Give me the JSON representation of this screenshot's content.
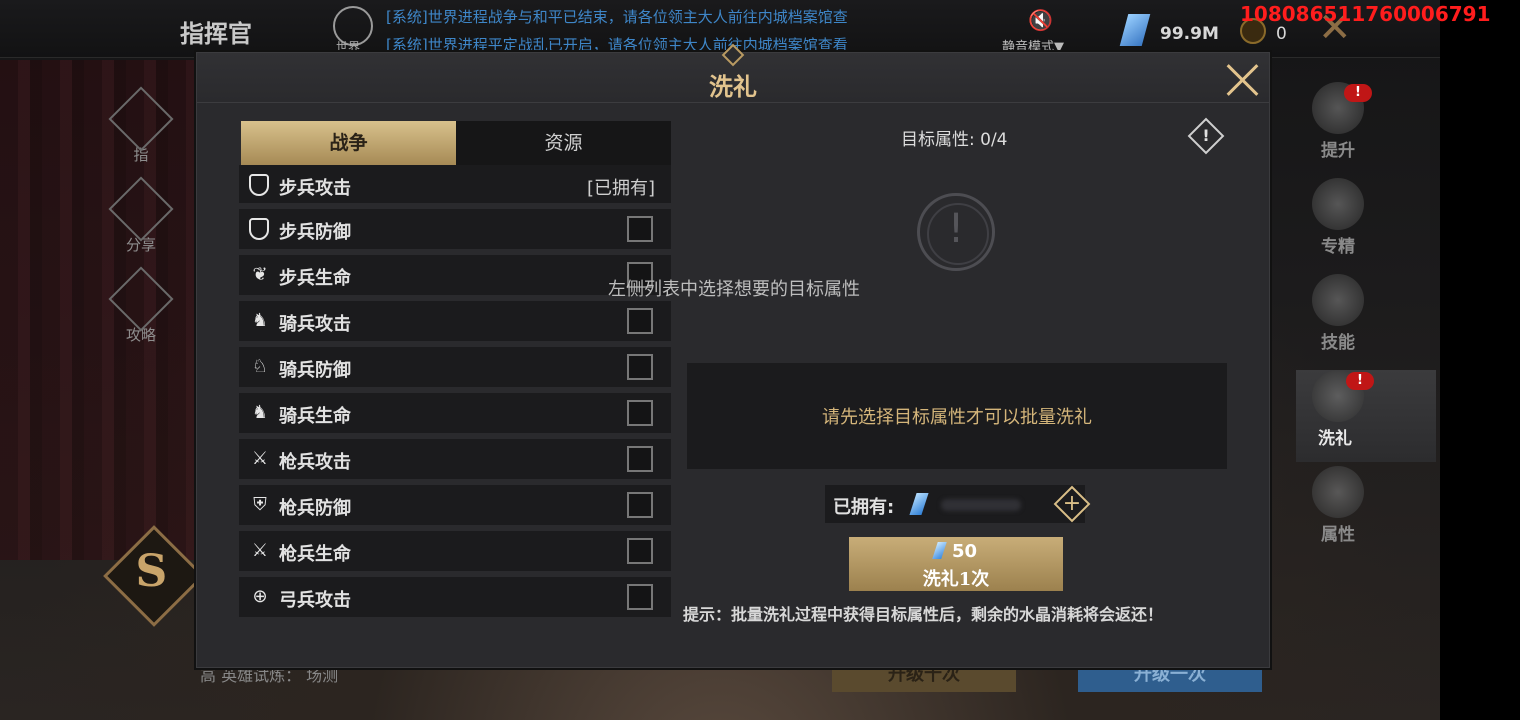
{
  "user_id": "108086511760006791",
  "topbar": {
    "title": "指挥官",
    "world_label": "世界",
    "news": [
      "[系统]世界进程战争与和平已结束，请各位领主大人前往内城档案馆查",
      "[系统]世界进程平定战乱已开启，请各位领主大人前往内城档案馆查看"
    ],
    "mute_label": "静音模式▼",
    "crystal_value": "99.9M",
    "coin_value": "0"
  },
  "left_menu": {
    "items": [
      "指",
      "分享",
      "攻略"
    ],
    "badge_letter": "S"
  },
  "right_menu": [
    {
      "label": "提升",
      "badge": "!"
    },
    {
      "label": "专精",
      "badge": ""
    },
    {
      "label": "技能",
      "badge": ""
    },
    {
      "label": "洗礼",
      "badge": "!",
      "active": true
    },
    {
      "label": "属性",
      "badge": ""
    }
  ],
  "background": {
    "upgrade_ten": "升级十次",
    "upgrade_one": "升级一次",
    "bottom_text": "高  英雄试炼：  场测"
  },
  "modal": {
    "title": "洗礼",
    "tabs": [
      {
        "label": "战争",
        "active": true
      },
      {
        "label": "资源",
        "active": false
      }
    ],
    "attributes": [
      {
        "label": "步兵攻击",
        "owned": "[已拥有]",
        "icon": "shield-icon"
      },
      {
        "label": "步兵防御",
        "owned": "",
        "icon": "shield-icon"
      },
      {
        "label": "步兵生命",
        "owned": "",
        "icon": "shield-heart-icon"
      },
      {
        "label": "骑兵攻击",
        "owned": "",
        "icon": "horse-icon"
      },
      {
        "label": "骑兵防御",
        "owned": "",
        "icon": "horse-shield-icon"
      },
      {
        "label": "骑兵生命",
        "owned": "",
        "icon": "horse-heart-icon"
      },
      {
        "label": "枪兵攻击",
        "owned": "",
        "icon": "crossed-spears-icon"
      },
      {
        "label": "枪兵防御",
        "owned": "",
        "icon": "spear-shield-icon"
      },
      {
        "label": "枪兵生命",
        "owned": "",
        "icon": "spear-heart-icon"
      },
      {
        "label": "弓兵攻击",
        "owned": "",
        "icon": "bow-icon"
      }
    ],
    "target_label": "目标属性: 0/4",
    "info_glyph": "!",
    "empty_hint": "左侧列表中选择想要的目标属性",
    "batch_hint": "请先选择目标属性才可以批量洗礼",
    "owned_label": "已拥有:",
    "wash_cost": "50",
    "wash_label": "洗礼1次",
    "tip": "提示：批量洗礼过程中获得目标属性后，剩余的水晶消耗将会返还！"
  }
}
